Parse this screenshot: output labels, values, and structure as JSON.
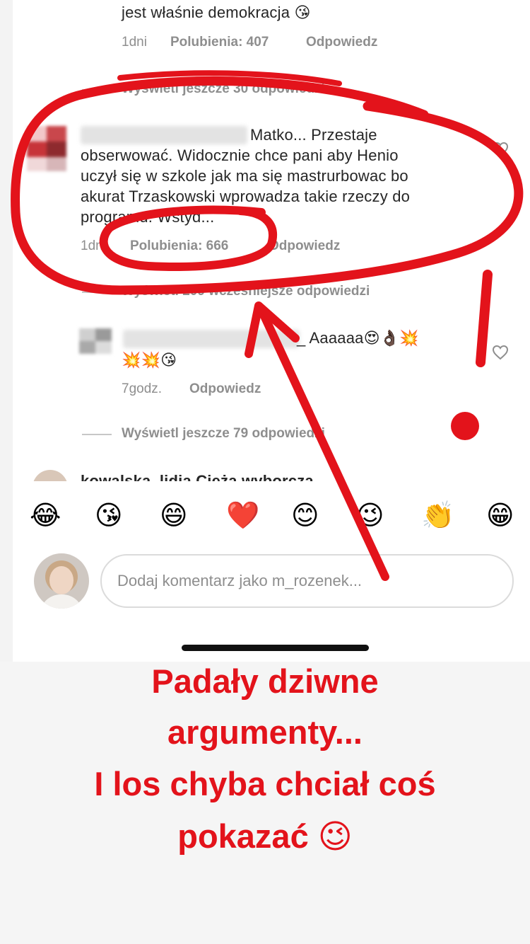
{
  "top_comment": {
    "text_tail": "jest właśnie demokracja 😘",
    "time": "1dni",
    "likes": "Polubienia: 407",
    "reply": "Odpowiedz"
  },
  "view_more_1": "Wyświetl jeszcze 30 odpowiedzi",
  "highlighted_comment": {
    "lines": [
      "Matko... Przestaje",
      "obserwować. Widocznie chce pani aby Henio",
      "uczył się w szkole jak ma się mastrurbowac bo",
      "akurat Trzaskowski wprowadza takie rzeczy do",
      "programu. Wstyd..."
    ],
    "time": "1dni",
    "likes": "Polubienia: 666",
    "reply": "Odpowiedz"
  },
  "view_earlier": "Wyświetl 209 wcześniejsze odpowiedzi",
  "reply_comment": {
    "line1": "_ Aaaaaa😍👌🏿💥",
    "line2": "💥💥😘",
    "time": "7godz.",
    "reply": "Odpowiedz"
  },
  "view_more_2": "Wyświetl jeszcze 79 odpowiedzi",
  "next_comment_peek": "kowalska_lidia Ciężą wyborcza...",
  "reactions": [
    "😂",
    "😘",
    "😄",
    "❤️",
    "😊",
    "😉",
    "👏",
    "😁"
  ],
  "input": {
    "placeholder": "Dodaj komentarz jako m_rozenek..."
  },
  "story_caption": [
    "Padały dziwne",
    "argumenty...",
    "I los chyba chciał coś",
    "pokazać 😉"
  ],
  "colors": {
    "annotation_red": "#e3131b",
    "meta_gray": "#8e8e8e",
    "text": "#262626"
  },
  "icons": [
    "heart-outline-icon",
    "avatar"
  ]
}
